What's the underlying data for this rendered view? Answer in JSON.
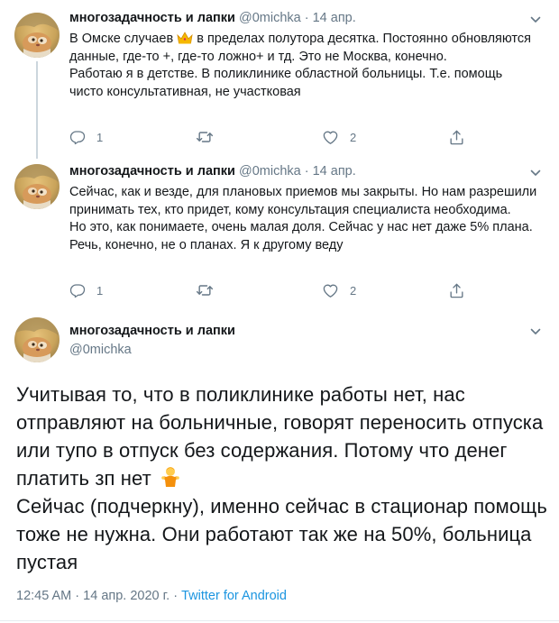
{
  "tweets": [
    {
      "name": "многозадачность и лапки",
      "handle": "@0michka",
      "date": "14 апр.",
      "text": [
        "В Омске случаев",
        "в пределах полутора десятка. Постоянно обновляются данные, где-то +, где-то ложно+ и тд. Это не Москва, конечно.",
        "Работаю я в детстве. В поликлинике областной больницы. Т.е. помощь чисто консультативная, не участковая"
      ],
      "reply_count": "1",
      "retweet_count": "",
      "like_count": "2"
    },
    {
      "name": "многозадачность и лапки",
      "handle": "@0michka",
      "date": "14 апр.",
      "text": [
        "Сейчас, как и везде, для плановых приемов мы закрыты. Но нам разрешили принимать тех, кто придет, кому консультация специалиста необходима.",
        "Но это, как понимаете, очень малая доля. Сейчас у нас нет даже 5% плана. Речь, конечно, не о планах. Я к другому веду"
      ],
      "reply_count": "1",
      "retweet_count": "",
      "like_count": "2"
    }
  ],
  "main_tweet": {
    "name": "многозадачность и лапки",
    "handle": "@0michka",
    "text": [
      "Учитывая то, что в поликлинике работы нет, нас отправляют на больничные, говорят переносить отпуска или тупо в отпуск без содержания. Потому что денег платить зп нет",
      "Сейчас (подчеркну), именно сейчас в стационар помощь тоже не нужна. Они работают так же на 50%, больница пустая"
    ],
    "time": "12:45 AM",
    "date": "14 апр. 2020 г.",
    "source": "Twitter for Android"
  },
  "separator_dot": "·",
  "icons": {
    "reply": "reply-icon",
    "retweet": "retweet-icon",
    "like": "heart-icon",
    "share": "share-icon",
    "more": "chevron-down-icon",
    "emoji_crown": "crown-emoji",
    "emoji_person": "person-shrugging-emoji"
  },
  "colors": {
    "text": "#14171a",
    "secondary": "#657786",
    "link": "#1b95e0",
    "line": "#ccd6dd"
  }
}
